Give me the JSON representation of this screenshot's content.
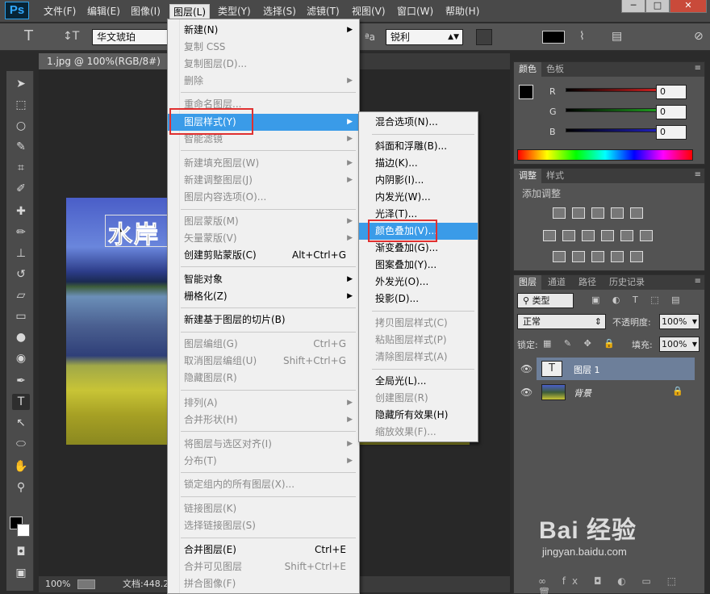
{
  "app": {
    "logo": "Ps"
  },
  "menubar": {
    "items": [
      "文件(F)",
      "编辑(E)",
      "图像(I)",
      "图层(L)",
      "类型(Y)",
      "选择(S)",
      "滤镜(T)",
      "视图(V)",
      "窗口(W)",
      "帮助(H)"
    ],
    "window_controls": {
      "minimize": "─",
      "restore": "□",
      "close": "✕"
    }
  },
  "options": {
    "tool_icon": "T",
    "orient_icon": "↕T",
    "font_family": "华文琥珀",
    "aa_label": "ªa",
    "anti_alias": "锐利",
    "color_hex": "#000000"
  },
  "document": {
    "tab_title": "1.jpg @ 100%(RGB/8#)",
    "text_layer_content": "水岸",
    "status_zoom": "100%",
    "status_doc": "文档:448.2"
  },
  "layer_menu": {
    "items": [
      {
        "label": "新建(N)",
        "disabled": false,
        "arrow": true
      },
      {
        "label": "复制 CSS",
        "disabled": true
      },
      {
        "label": "复制图层(D)...",
        "disabled": true
      },
      {
        "label": "删除",
        "disabled": true,
        "arrow": true
      },
      {
        "label": "重命名图层...",
        "disabled": true
      },
      {
        "label": "图层样式(Y)",
        "highlighted": true,
        "arrow": true
      },
      {
        "label": "智能滤镜",
        "disabled": true,
        "arrow": true
      },
      {
        "label": "新建填充图层(W)",
        "disabled": true,
        "arrow": true
      },
      {
        "label": "新建调整图层(J)",
        "disabled": true,
        "arrow": true
      },
      {
        "label": "图层内容选项(O)...",
        "disabled": true
      },
      {
        "label": "图层蒙版(M)",
        "disabled": true,
        "arrow": true
      },
      {
        "label": "矢量蒙版(V)",
        "disabled": true,
        "arrow": true
      },
      {
        "label": "创建剪贴蒙版(C)",
        "shortcut": "Alt+Ctrl+G"
      },
      {
        "label": "智能对象",
        "arrow": true
      },
      {
        "label": "栅格化(Z)",
        "arrow": true
      },
      {
        "label": "新建基于图层的切片(B)"
      },
      {
        "label": "图层编组(G)",
        "disabled": true,
        "shortcut": "Ctrl+G"
      },
      {
        "label": "取消图层编组(U)",
        "disabled": true,
        "shortcut": "Shift+Ctrl+G"
      },
      {
        "label": "隐藏图层(R)",
        "disabled": true
      },
      {
        "label": "排列(A)",
        "disabled": true,
        "arrow": true
      },
      {
        "label": "合并形状(H)",
        "disabled": true,
        "arrow": true
      },
      {
        "label": "将图层与选区对齐(I)",
        "disabled": true,
        "arrow": true
      },
      {
        "label": "分布(T)",
        "disabled": true,
        "arrow": true
      },
      {
        "label": "锁定组内的所有图层(X)...",
        "disabled": true
      },
      {
        "label": "链接图层(K)",
        "disabled": true
      },
      {
        "label": "选择链接图层(S)",
        "disabled": true
      },
      {
        "label": "合并图层(E)",
        "shortcut": "Ctrl+E"
      },
      {
        "label": "合并可见图层",
        "disabled": true,
        "shortcut": "Shift+Ctrl+E"
      },
      {
        "label": "拼合图像(F)",
        "disabled": true
      }
    ]
  },
  "style_submenu": {
    "items": [
      {
        "label": "混合选项(N)..."
      },
      {
        "label": "斜面和浮雕(B)..."
      },
      {
        "label": "描边(K)..."
      },
      {
        "label": "内阴影(I)..."
      },
      {
        "label": "内发光(W)..."
      },
      {
        "label": "光泽(T)..."
      },
      {
        "label": "颜色叠加(V)...",
        "highlighted": true
      },
      {
        "label": "渐变叠加(G)..."
      },
      {
        "label": "图案叠加(Y)..."
      },
      {
        "label": "外发光(O)..."
      },
      {
        "label": "投影(D)..."
      },
      {
        "label": "拷贝图层样式(C)",
        "disabled": true
      },
      {
        "label": "粘贴图层样式(P)",
        "disabled": true
      },
      {
        "label": "清除图层样式(A)",
        "disabled": true
      },
      {
        "label": "全局光(L)..."
      },
      {
        "label": "创建图层(R)",
        "disabled": true
      },
      {
        "label": "隐藏所有效果(H)"
      },
      {
        "label": "缩放效果(F)...",
        "disabled": true
      }
    ]
  },
  "color_panel": {
    "tabs": [
      "颜色",
      "色板"
    ],
    "channels": [
      {
        "label": "R",
        "value": "0",
        "color": "#d02020"
      },
      {
        "label": "G",
        "value": "0",
        "color": "#20a020"
      },
      {
        "label": "B",
        "value": "0",
        "color": "#2020c0"
      }
    ]
  },
  "adjust_panel": {
    "tabs": [
      "调整",
      "样式"
    ],
    "title": "添加调整"
  },
  "layers_panel": {
    "tabs": [
      "图层",
      "通道",
      "路径",
      "历史记录"
    ],
    "filter": "类型",
    "blend_mode": "正常",
    "opacity_label": "不透明度:",
    "opacity": "100%",
    "lock_label": "锁定:",
    "fill_label": "填充:",
    "fill": "100%",
    "layers": [
      {
        "name": "图层 1",
        "thumb": "T",
        "selected": true
      },
      {
        "name": "背景",
        "locked": true
      }
    ]
  },
  "watermark": {
    "text": "Bai  经验",
    "url": "jingyan.baidu.com"
  }
}
